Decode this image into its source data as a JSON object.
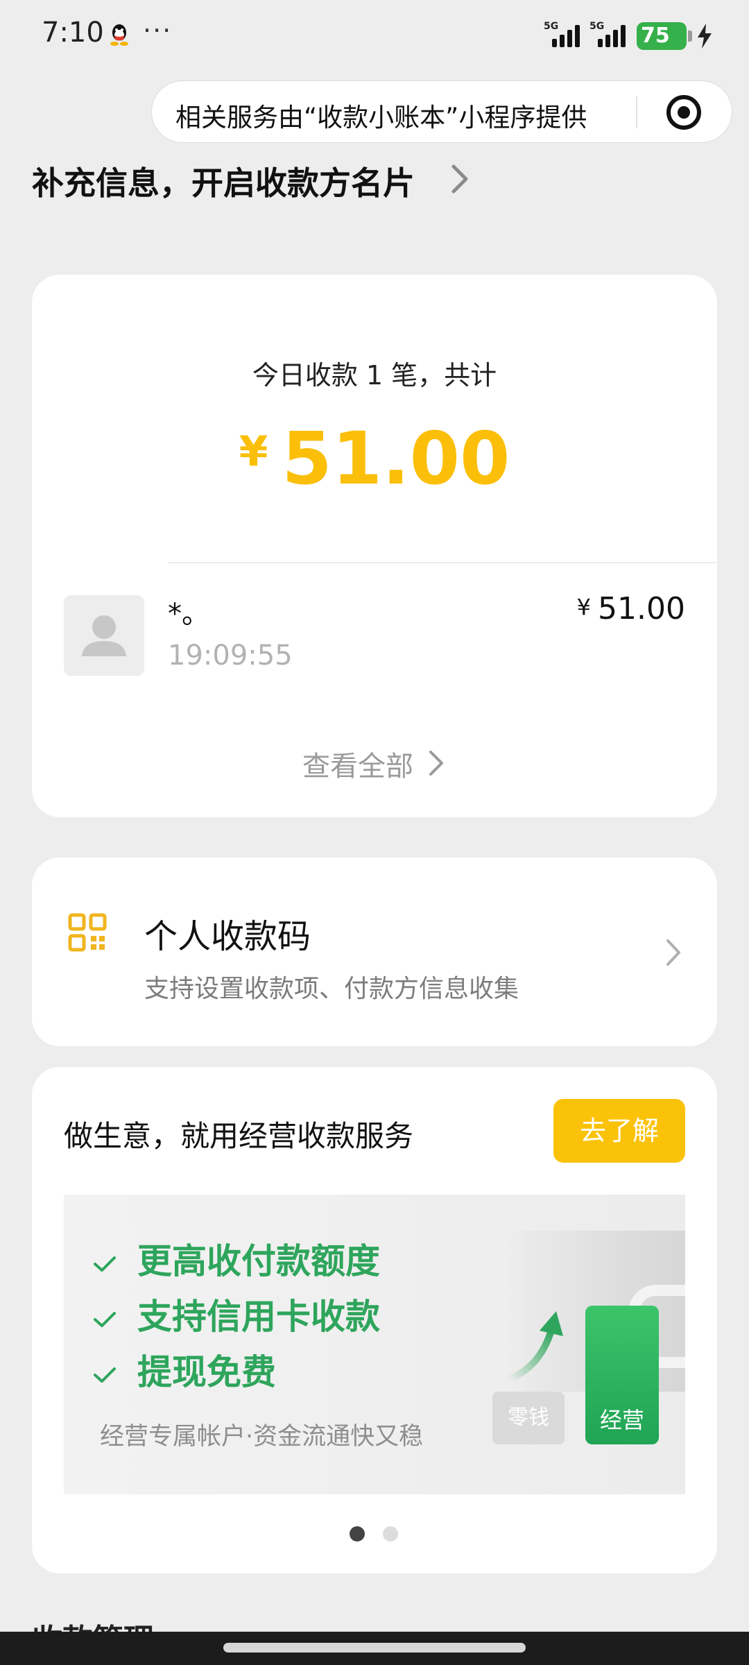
{
  "status_bar": {
    "time": "7:10",
    "more": "···",
    "signal_1_label": "5G",
    "signal_2_label": "5G",
    "battery": "75"
  },
  "capsule": {
    "text": "相关服务由“收款小账本”小程序提供"
  },
  "header": {
    "info_link": "补充信息，开启收款方名片"
  },
  "summary": {
    "label": "今日收款 1 笔，共计",
    "currency": "¥",
    "total": "51.00",
    "transaction": {
      "name": "*。",
      "time": "19:09:55",
      "currency": "¥",
      "amount": "51.00"
    },
    "view_all": "查看全部"
  },
  "personal_qr": {
    "title": "个人收款码",
    "subtitle": "支持设置收款项、付款方信息收集"
  },
  "business": {
    "title": "做生意，就用经营收款服务",
    "button": "去了解",
    "banner": {
      "features": [
        "更高收付款额度",
        "支持信用卡收款",
        "提现免费"
      ],
      "subtitle": "经营专属帐户·资金流通快又稳",
      "tile_change": "零钱",
      "tile_business": "经营"
    },
    "page_indicator": {
      "current": 1,
      "total": 2
    }
  },
  "next_section": {
    "title": "收款管理"
  },
  "colors": {
    "accent_yellow": "#fbbf0a",
    "accent_green": "#2ea55c",
    "background": "#ededed",
    "battery_green": "#35b04a"
  },
  "icons": {
    "qr": "qr-code-icon",
    "avatar": "default-avatar-icon",
    "chevron": "chevron-right-icon",
    "target": "target-icon",
    "check": "check-icon"
  }
}
